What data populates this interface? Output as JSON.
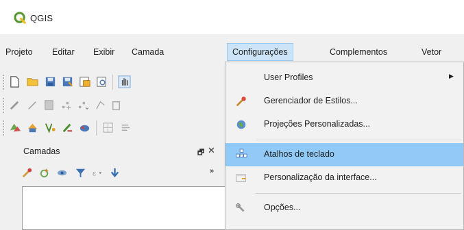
{
  "app": {
    "title": "QGIS",
    "logo_icon": "qgis-logo-icon",
    "brand_color": "#589632"
  },
  "menubar": {
    "items": [
      {
        "label": "Projeto"
      },
      {
        "label": "Editar"
      },
      {
        "label": "Exibir"
      },
      {
        "label": "Camada"
      },
      {
        "label": "Configurações",
        "active": true
      },
      {
        "label": "Complementos"
      },
      {
        "label": "Vetor"
      }
    ]
  },
  "toolbars": {
    "row1_icons": [
      "new-project-icon",
      "open-folder-icon",
      "save-icon",
      "save-as-icon",
      "layout-icon",
      "layout-manager-icon",
      "pan-hand-icon"
    ],
    "row2_icons": [
      "digitize-pencil-icon",
      "edit-line-icon",
      "save-edits-icon",
      "add-feature-icon",
      "move-feature-icon",
      "node-tool-icon",
      "delete-icon"
    ],
    "row3_icons": [
      "data-source-manager-icon",
      "add-layer-icon",
      "vector-layer-icon",
      "raster-layer-icon",
      "virtual-layer-icon",
      "mesh-layer-icon",
      "attribute-icon"
    ]
  },
  "layers_panel": {
    "title": "Camadas",
    "float_icon": "float-panel-icon",
    "close_icon": "close-icon",
    "toolbar_icons": [
      "style-brush-icon",
      "add-group-icon",
      "visibility-eye-icon",
      "filter-icon",
      "filter-expression-icon",
      "expand-all-icon"
    ],
    "more_label": "»"
  },
  "settings_menu": {
    "items": [
      {
        "label": "User Profiles",
        "icon": "none",
        "submenu": true
      },
      {
        "label": "Gerenciador de Estilos...",
        "icon": "style-manager-brush-icon"
      },
      {
        "label": "Projeções Personalizadas...",
        "icon": "globe-projection-icon"
      },
      {
        "label": "Atalhos de teclado",
        "icon": "keyboard-shortcuts-icon",
        "highlighted": true
      },
      {
        "label": "Personalização da interface...",
        "icon": "interface-customization-icon"
      },
      {
        "label": "Opções...",
        "icon": "options-wrench-icon"
      }
    ],
    "highlight_color": "#91c9f7"
  }
}
